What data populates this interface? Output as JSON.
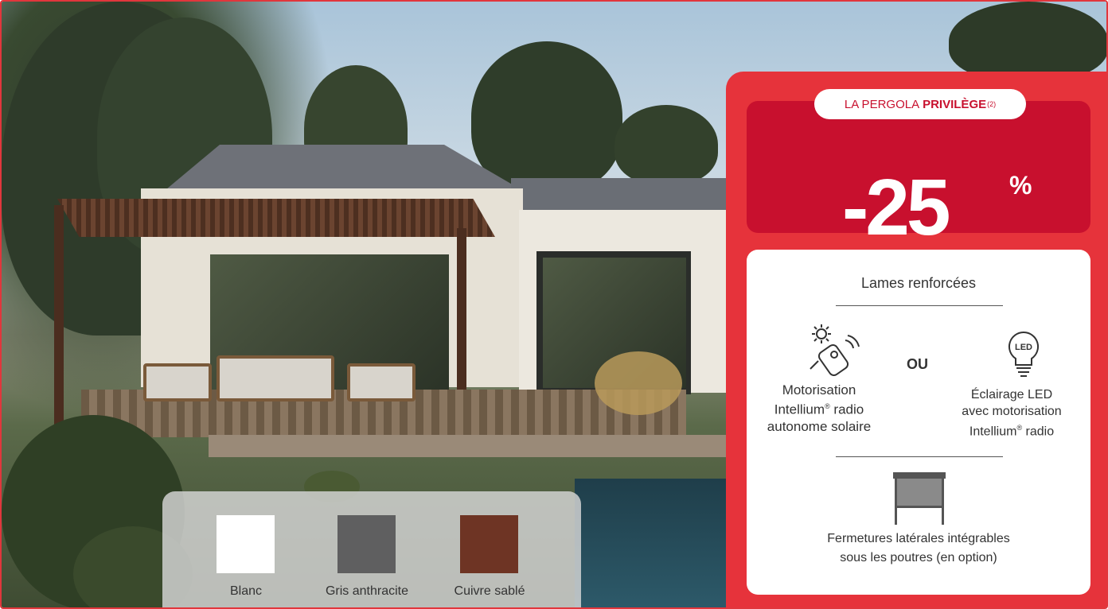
{
  "promo": {
    "pill_prefix": "LA PERGOLA",
    "pill_bold": "PRIVILÈGE",
    "pill_note": "(2)",
    "discount": "-25",
    "percent": "%",
    "features": {
      "title": "Lames renforcées",
      "option_a_line1": "Motorisation",
      "option_a_line2": "Intellium",
      "option_a_reg": "®",
      "option_a_line2b": " radio",
      "option_a_line3": "autonome  solaire",
      "or_label": "OU",
      "option_b_line1": "Éclairage LED",
      "option_b_line2": "avec motorisation",
      "option_b_line3a": "Intellium",
      "option_b_reg": "®",
      "option_b_line3b": " radio",
      "led_icon_text": "LED",
      "closure_line1": "Fermetures latérales intégrables",
      "closure_line2": "sous les poutres (en option)"
    }
  },
  "swatches": [
    {
      "label": "Blanc",
      "color": "#ffffff"
    },
    {
      "label": "Gris anthracite",
      "color": "#5f5f60"
    },
    {
      "label": "Cuivre sablé",
      "color": "#6e3424"
    }
  ],
  "colors": {
    "brand_red": "#e6333b",
    "dark_red": "#c8102e"
  }
}
